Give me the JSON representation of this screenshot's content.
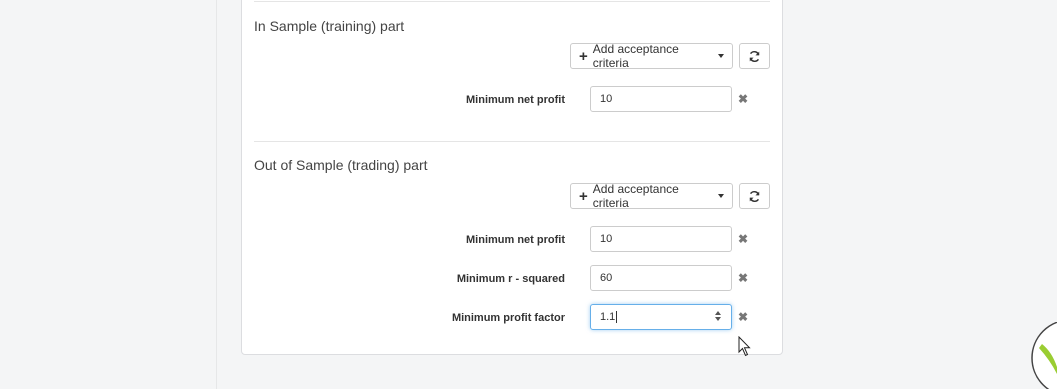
{
  "in_sample": {
    "heading": "In Sample (training) part",
    "add_button": "Add acceptance criteria",
    "criteria": [
      {
        "label": "Minimum net profit",
        "value": "10"
      }
    ]
  },
  "out_sample": {
    "heading": "Out of Sample (trading) part",
    "add_button": "Add acceptance criteria",
    "criteria": [
      {
        "label": "Minimum net profit",
        "value": "10"
      },
      {
        "label": "Minimum r - squared",
        "value": "60"
      },
      {
        "label": "Minimum profit factor",
        "value": "1.1"
      }
    ]
  },
  "icons": {
    "add": "plus-icon",
    "dropdown": "caret-down-icon",
    "refresh": "refresh-icon",
    "remove": "remove-x-icon",
    "spinner": "spinner-arrows-icon",
    "pointer": "mouse-pointer-icon"
  },
  "colors": {
    "focus_border": "#66afe9",
    "panel_border": "#dcdde0",
    "background": "#f4f5f6"
  }
}
